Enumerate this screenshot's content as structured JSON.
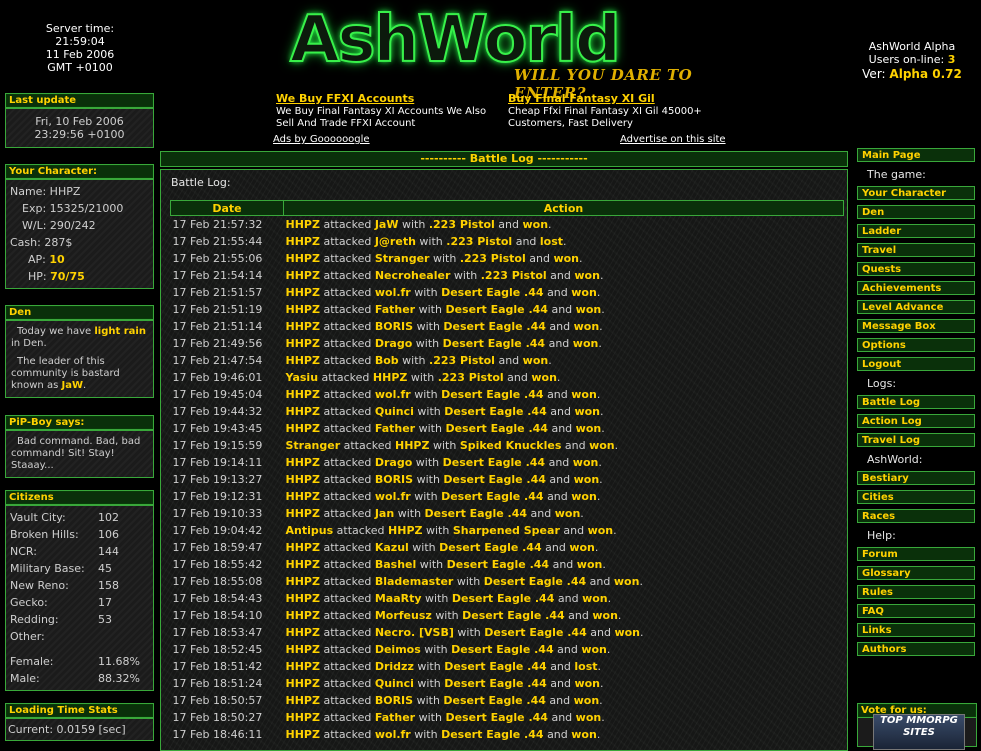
{
  "server": {
    "label": "Server time:",
    "time": "21:59:04",
    "date": "11 Feb 2006",
    "tz": "GMT +0100"
  },
  "logo": {
    "title": "AshWorld",
    "tagline": "WILL YOU DARE TO ENTER?"
  },
  "site": {
    "name": "AshWorld Alpha",
    "users_label": "Users on-line:",
    "users": "3",
    "ver_label": "Ver:",
    "ver": "Alpha 0.72"
  },
  "ads": [
    {
      "title": "We Buy FFXI Accounts",
      "text": "We Buy Final Fantasy XI Accounts We Also Sell And Trade FFXI Account"
    },
    {
      "title": "Buy Final Fantasy XI Gil",
      "text": "Cheap Ffxi Final Fantasy XI Gil 45000+ Customers, Fast Delivery"
    }
  ],
  "ads_by": "Ads by Goooooogle",
  "advertise": "Advertise on this site",
  "last_update": {
    "title": "Last update",
    "line1": "Fri, 10 Feb 2006",
    "line2": "23:29:56 +0100"
  },
  "character": {
    "title": "Your Character:",
    "name_label": "Name:",
    "name": "HHPZ",
    "exp_label": "Exp:",
    "exp": "15325/21000",
    "wl_label": "W/L:",
    "wl": "290/242",
    "cash_label": "Cash:",
    "cash": "287$",
    "ap_label": "AP:",
    "ap": "10",
    "hp_label": "HP:",
    "hp": "70/75"
  },
  "den": {
    "title": "Den",
    "weather_pre": "Today we have",
    "weather": "light rain",
    "weather_post": "in Den.",
    "leader_pre": "The leader of this community is bastard known as",
    "leader": "JaW",
    "leader_post": "."
  },
  "pipboy": {
    "title": "PiP-Boy says:",
    "text": "Bad command. Bad, bad command! Sit! Stay! Staaay..."
  },
  "citizens": {
    "title": "Citizens",
    "rows": [
      {
        "k": "Vault City:",
        "v": "102"
      },
      {
        "k": "Broken Hills:",
        "v": "106"
      },
      {
        "k": "NCR:",
        "v": "144"
      },
      {
        "k": "Military Base:",
        "v": "45"
      },
      {
        "k": "New Reno:",
        "v": "158"
      },
      {
        "k": "Gecko:",
        "v": "17"
      },
      {
        "k": "Redding:",
        "v": "53"
      },
      {
        "k": "Other:",
        "v": ""
      }
    ],
    "female_label": "Female:",
    "female": "11.68%",
    "male_label": "Male:",
    "male": "88.32%"
  },
  "loading": {
    "title": "Loading Time Stats",
    "current_label": "Current:",
    "current": "0.0159 [sec]"
  },
  "battle": {
    "header": "---------- Battle Log -----------",
    "label": "Battle Log:",
    "col_date": "Date",
    "col_action": "Action",
    "rows": [
      [
        "17 Feb 21:57:32",
        "HHPZ",
        "JaW",
        ".223 Pistol",
        "won"
      ],
      [
        "17 Feb 21:55:44",
        "HHPZ",
        "J@reth",
        ".223 Pistol",
        "lost"
      ],
      [
        "17 Feb 21:55:06",
        "HHPZ",
        "Stranger",
        ".223 Pistol",
        "won"
      ],
      [
        "17 Feb 21:54:14",
        "HHPZ",
        "Necrohealer",
        ".223 Pistol",
        "won"
      ],
      [
        "17 Feb 21:51:57",
        "HHPZ",
        "wol.fr",
        "Desert Eagle .44",
        "won"
      ],
      [
        "17 Feb 21:51:19",
        "HHPZ",
        "Father",
        "Desert Eagle .44",
        "won"
      ],
      [
        "17 Feb 21:51:14",
        "HHPZ",
        "BORIS",
        "Desert Eagle .44",
        "won"
      ],
      [
        "17 Feb 21:49:56",
        "HHPZ",
        "Drago",
        "Desert Eagle .44",
        "won"
      ],
      [
        "17 Feb 21:47:54",
        "HHPZ",
        "Bob",
        ".223 Pistol",
        "won"
      ],
      [
        "17 Feb 19:46:01",
        "Yasiu",
        "HHPZ",
        ".223 Pistol",
        "won"
      ],
      [
        "17 Feb 19:45:04",
        "HHPZ",
        "wol.fr",
        "Desert Eagle .44",
        "won"
      ],
      [
        "17 Feb 19:44:32",
        "HHPZ",
        "Quinci",
        "Desert Eagle .44",
        "won"
      ],
      [
        "17 Feb 19:43:45",
        "HHPZ",
        "Father",
        "Desert Eagle .44",
        "won"
      ],
      [
        "17 Feb 19:15:59",
        "Stranger",
        "HHPZ",
        "Spiked Knuckles",
        "won"
      ],
      [
        "17 Feb 19:14:11",
        "HHPZ",
        "Drago",
        "Desert Eagle .44",
        "won"
      ],
      [
        "17 Feb 19:13:27",
        "HHPZ",
        "BORIS",
        "Desert Eagle .44",
        "won"
      ],
      [
        "17 Feb 19:12:31",
        "HHPZ",
        "wol.fr",
        "Desert Eagle .44",
        "won"
      ],
      [
        "17 Feb 19:10:33",
        "HHPZ",
        "Jan",
        "Desert Eagle .44",
        "won"
      ],
      [
        "17 Feb 19:04:42",
        "Antipus",
        "HHPZ",
        "Sharpened Spear",
        "won"
      ],
      [
        "17 Feb 18:59:47",
        "HHPZ",
        "Kazul",
        "Desert Eagle .44",
        "won"
      ],
      [
        "17 Feb 18:55:42",
        "HHPZ",
        "Bashel",
        "Desert Eagle .44",
        "won"
      ],
      [
        "17 Feb 18:55:08",
        "HHPZ",
        "Blademaster",
        "Desert Eagle .44",
        "won"
      ],
      [
        "17 Feb 18:54:43",
        "HHPZ",
        "MaaRty",
        "Desert Eagle .44",
        "won"
      ],
      [
        "17 Feb 18:54:10",
        "HHPZ",
        "Morfeusz",
        "Desert Eagle .44",
        "won"
      ],
      [
        "17 Feb 18:53:47",
        "HHPZ",
        "Necro. [VSB]",
        "Desert Eagle .44",
        "won"
      ],
      [
        "17 Feb 18:52:45",
        "HHPZ",
        "Deimos",
        "Desert Eagle .44",
        "won"
      ],
      [
        "17 Feb 18:51:42",
        "HHPZ",
        "Dridzz",
        "Desert Eagle .44",
        "lost"
      ],
      [
        "17 Feb 18:51:24",
        "HHPZ",
        "Quinci",
        "Desert Eagle .44",
        "won"
      ],
      [
        "17 Feb 18:50:57",
        "HHPZ",
        "BORIS",
        "Desert Eagle .44",
        "won"
      ],
      [
        "17 Feb 18:50:27",
        "HHPZ",
        "Father",
        "Desert Eagle .44",
        "won"
      ],
      [
        "17 Feb 18:46:11",
        "HHPZ",
        "wol.fr",
        "Desert Eagle .44",
        "won"
      ]
    ],
    "word_attacked": "attacked",
    "word_with": "with",
    "word_and": "and"
  },
  "nav": {
    "main_page": "Main Page",
    "game_label": "The game:",
    "game": [
      "Your Character",
      "Den",
      "Ladder",
      "Travel",
      "Quests",
      "Achievements",
      "Level Advance",
      "Message Box",
      "Options",
      "Logout"
    ],
    "logs_label": "Logs:",
    "logs": [
      "Battle Log",
      "Action Log",
      "Travel Log"
    ],
    "ashworld_label": "AshWorld:",
    "ashworld": [
      "Bestiary",
      "Cities",
      "Races"
    ],
    "help_label": "Help:",
    "help": [
      "Forum",
      "Glossary",
      "Rules",
      "FAQ",
      "Links",
      "Authors"
    ],
    "vote_title": "Vote for us:",
    "vote_img_text": "TOP MMORPG SITES"
  },
  "colors": {
    "accent_green": "#39a83a",
    "header_bg": "#0a300a",
    "highlight": "#ffd200"
  }
}
